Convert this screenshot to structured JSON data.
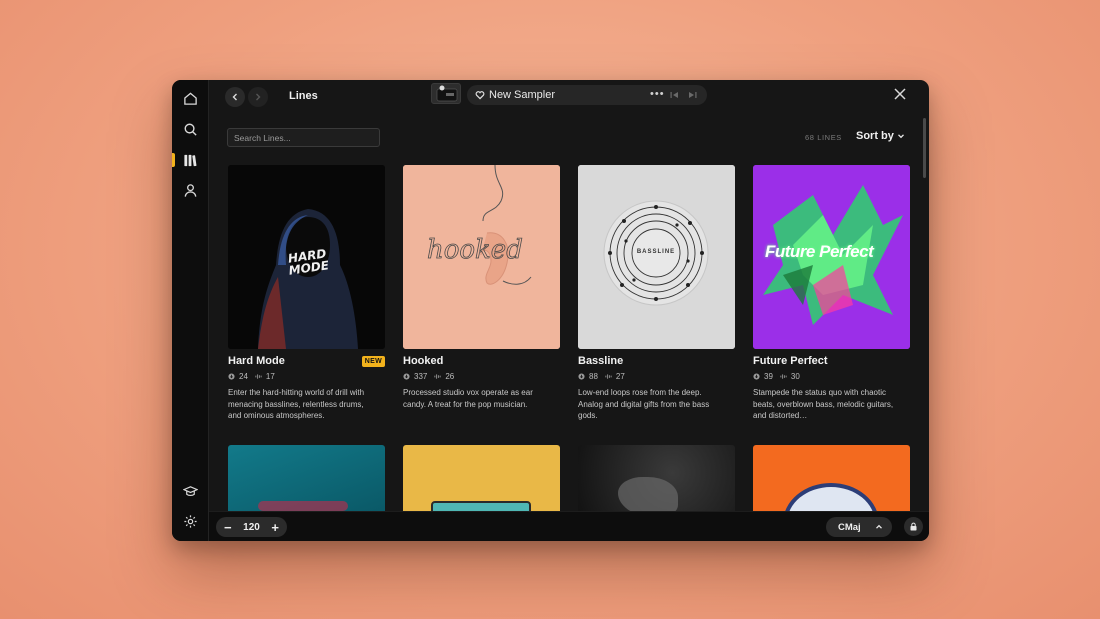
{
  "header": {
    "title": "Lines",
    "sampler_name": "New Sampler",
    "more_label": "•••"
  },
  "search": {
    "placeholder": "Search Lines..."
  },
  "toolbar": {
    "lines_count": "68 LINES",
    "sort_label": "Sort by"
  },
  "cards": [
    {
      "title": "Hard Mode",
      "badge": "NEW",
      "stat1": "24",
      "stat2": "17",
      "description": "Enter the hard-hitting world of drill with menacing basslines, relentless drums, and ominous atmospheres.",
      "art_text": "HARD MODE"
    },
    {
      "title": "Hooked",
      "stat1": "337",
      "stat2": "26",
      "description": "Processed studio vox operate as ear candy. A treat for the pop musician.",
      "art_text": "hooked"
    },
    {
      "title": "Bassline",
      "stat1": "88",
      "stat2": "27",
      "description": "Low-end loops rose from the deep. Analog and digital gifts from the bass gods.",
      "art_text": "BASSLINE"
    },
    {
      "title": "Future Perfect",
      "stat1": "39",
      "stat2": "30",
      "description": "Stampede the status quo with chaotic beats, overblown bass, melodic guitars, and distorted…",
      "art_text": "Future Perfect"
    }
  ],
  "bottom": {
    "tempo": "120",
    "minus": "−",
    "plus": "+",
    "key": "CMaj"
  },
  "colors": {
    "accent": "#f2b21c",
    "background": "#161616",
    "sidebar": "#0d0d0d"
  }
}
